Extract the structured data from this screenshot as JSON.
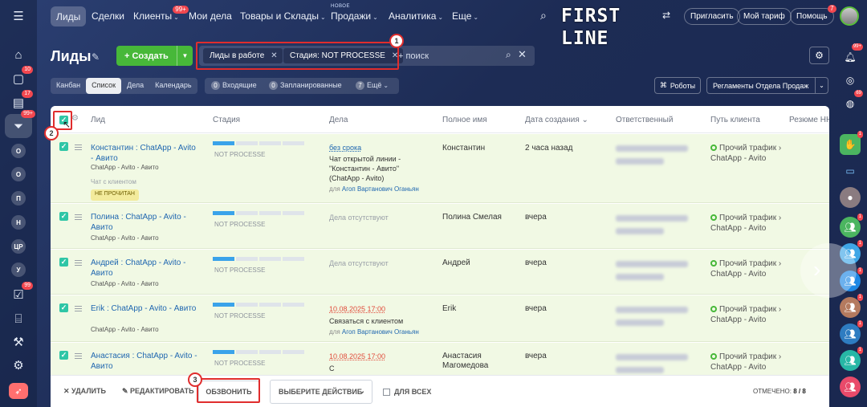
{
  "nav": {
    "items": [
      {
        "label": "Лиды"
      },
      {
        "label": "Сделки"
      },
      {
        "label": "Клиенты",
        "badge": "99+"
      },
      {
        "label": "Мои дела"
      },
      {
        "label": "Товары и Склады"
      },
      {
        "label": "Продажи",
        "tag": "НОВОЕ"
      },
      {
        "label": "Аналитика"
      },
      {
        "label": "Еще"
      }
    ],
    "logo": "FIRST LINE",
    "invite": "Пригласить",
    "tariff": "Мой тариф",
    "help": "Помощь",
    "help_badge": "7"
  },
  "leftbar": {
    "badges": {
      "chat": "10",
      "tasks": "17",
      "crm": "99+",
      "todo": "99"
    },
    "letters": [
      "О",
      "О",
      "П",
      "Н",
      "ЦР",
      "У"
    ]
  },
  "rightbar": {
    "badges": {
      "notify": "99+",
      "support": "69"
    },
    "chat_badges": [
      "1",
      "1",
      "1",
      "1",
      "1",
      "1",
      "1"
    ]
  },
  "header": {
    "title": "Лиды",
    "create_label": "+ Создать",
    "filters": [
      "Лиды в работе",
      "Стадия: NOT PROCESSE"
    ],
    "search_placeholder": "+ поиск"
  },
  "views": {
    "tabs": [
      "Канбан",
      "Список",
      "Дела",
      "Календарь"
    ],
    "active": "Список",
    "counters": [
      {
        "num": "0",
        "label": "Входящие"
      },
      {
        "num": "0",
        "label": "Запланированные"
      },
      {
        "num": "7",
        "label": "Ещё"
      }
    ],
    "robots": "Роботы",
    "reglament": "Регламенты Отдела Продаж"
  },
  "table": {
    "columns": [
      "Лид",
      "Стадия",
      "Дела",
      "Полное имя",
      "Дата создания",
      "Ответственный",
      "Путь клиента",
      "Резюме НН"
    ],
    "sort_column": "Дата создания",
    "stage_label": "NOT PROCESSE",
    "source_label": "ChatApp - Avito - Авито",
    "path_label": "Прочий трафик",
    "path_sub": "ChatApp - Avito",
    "rows": [
      {
        "lead": "Константин : ChatApp - Avito - Авито",
        "chat": "Чат с клиентом",
        "badge": "НЕ ПРОЧИТАН",
        "deal_date": "без срока",
        "deal_text": "Чат открытой линии - \"Константин - Авито\" (ChatApp - Avito)",
        "deal_for": "Агоп Вартанович Оганьян",
        "name": "Константин",
        "created": "2 часа назад"
      },
      {
        "lead": "Полина : ChatApp - Avito - Авито",
        "deal_none": "Дела отсутствуют",
        "name": "Полина Смелая",
        "created": "вчера"
      },
      {
        "lead": "Андрей : ChatApp - Avito - Авито",
        "deal_none": "Дела отсутствуют",
        "name": "Андрей",
        "created": "вчера"
      },
      {
        "lead": "Erik : ChatApp - Avito - Авито",
        "deal_date": "10.08.2025 17:00",
        "deal_text": "Связаться с клиентом",
        "deal_for": "Агоп Вартанович Оганьян",
        "name": "Erik",
        "created": "вчера"
      },
      {
        "lead": "Анастасия : ChatApp - Avito - Авито",
        "deal_date": "10.08.2025 17:00",
        "deal_text": "С",
        "name": "Анастасия Магомедова",
        "created": "вчера"
      }
    ]
  },
  "footer": {
    "delete": "УДАЛИТЬ",
    "edit": "РЕДАКТИРОВАТЬ",
    "call": "ОБЗВОНИТЬ",
    "action_select": "ВЫБЕРИТЕ ДЕЙСТВИЕ",
    "for_all": "ДЛЯ ВСЕХ",
    "marked_label": "ОТМЕЧЕНО:",
    "marked_value": "8 / 8"
  },
  "annotations": [
    "1",
    "2",
    "3"
  ],
  "colors": {
    "accent_green": "#47b839",
    "highlight_red": "#e02d2d",
    "checkbox": "#2fc6a6",
    "link": "#2067b0",
    "row_bg": "#f1f9e4"
  }
}
